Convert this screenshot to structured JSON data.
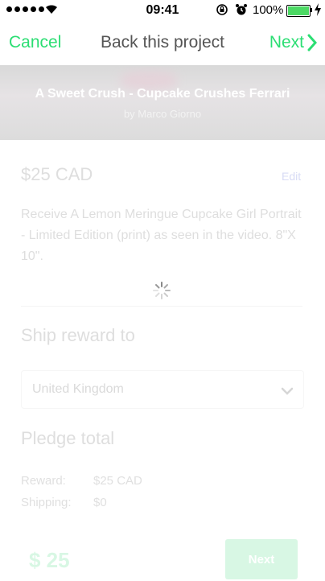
{
  "status_bar": {
    "time": "09:41",
    "battery_percent": "100%",
    "battery_level": 1.0,
    "signal_bars": 5
  },
  "nav": {
    "cancel_label": "Cancel",
    "title": "Back this project",
    "next_label": "Next"
  },
  "project": {
    "title": "A Sweet Crush - Cupcake Crushes Ferrari",
    "byline": "by Marco Giorno"
  },
  "reward": {
    "price": "$25 CAD",
    "edit_label": "Edit",
    "description": "Receive A Lemon Meringue Cupcake Girl Portrait - Limited Edition (print) as seen in the video. 8\"X 10\"."
  },
  "shipping": {
    "label": "Ship reward to",
    "country": "United Kingdom"
  },
  "pledge": {
    "label": "Pledge total",
    "reward_key": "Reward:",
    "reward_value": "$25 CAD",
    "shipping_key": "Shipping:",
    "shipping_value": "$0"
  },
  "footer": {
    "total": "$ 25",
    "next_label": "Next"
  },
  "colors": {
    "accent": "#2bde73",
    "faded_text": "#dedede",
    "faded_accent": "#d8f7e4"
  },
  "icons": {
    "wifi": "wifi-icon",
    "rotation_lock": "rotation-lock-icon",
    "alarm": "alarm-icon",
    "battery": "battery-icon",
    "charging": "charging-icon",
    "next": "chevron-right-icon",
    "dropdown": "chevron-down-icon",
    "loading": "spinner-icon"
  }
}
